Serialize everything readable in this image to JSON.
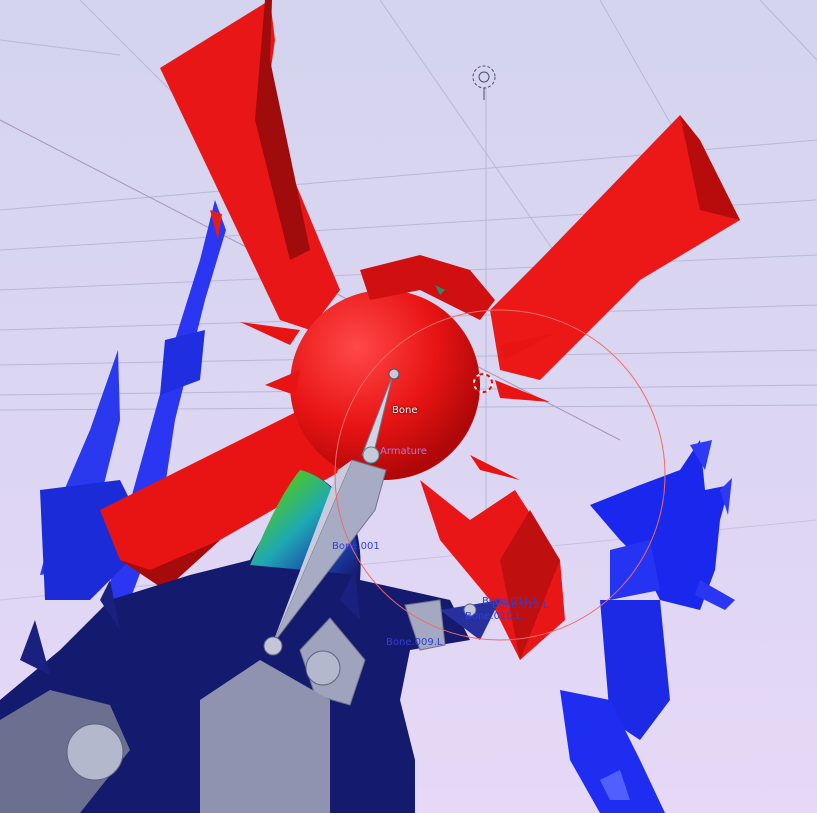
{
  "app": "3D viewport",
  "colors": {
    "background": "#d6d6ee",
    "red_mesh": "#e81414",
    "blue_mesh": "#1f2ef0",
    "navy_mesh": "#141a6e",
    "bone_gray": "#a7abc4",
    "label_white": "#ffffff",
    "label_purple": "#b07ad8",
    "label_blue": "#2f3fd8",
    "selection_circle": "#f06a6a"
  },
  "labels": {
    "bone": "Bone",
    "armature": "Armature",
    "bone_001": "Bone.001",
    "bone_009_l": "Bone.009.L",
    "bone_010_l": "Bone.010.L",
    "overlap_a": "Bone.011.L",
    "overlap_b": "Bone.012.L"
  },
  "icons": {
    "camera_target": "crosshair-icon",
    "cursor_3d": "3d-cursor-icon"
  }
}
